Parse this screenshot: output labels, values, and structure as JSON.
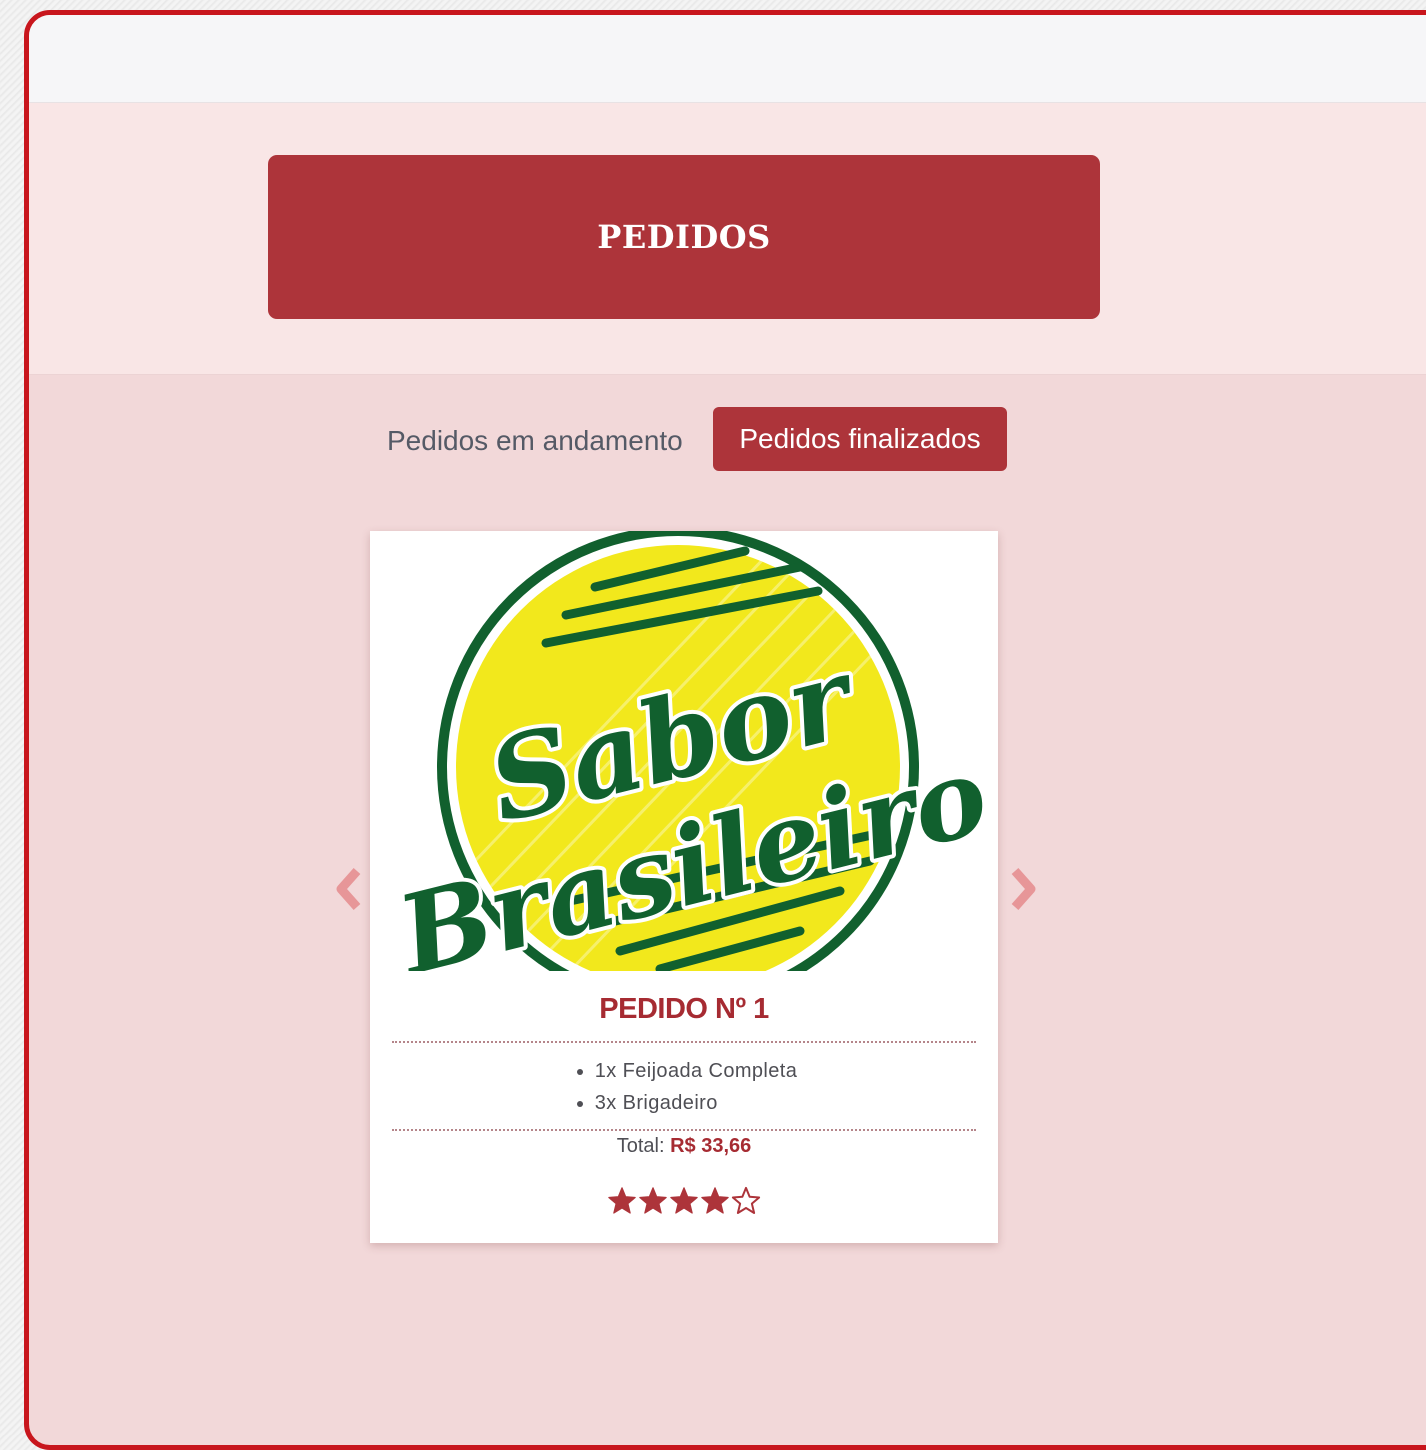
{
  "header": {
    "title": "PEDIDOS"
  },
  "tabs": {
    "in_progress_label": "Pedidos em andamento",
    "finished_label": "Pedidos finalizados",
    "active": "finished"
  },
  "carousel": {
    "prev_icon": "chevron-left-icon",
    "next_icon": "chevron-right-icon"
  },
  "order_card": {
    "logo_text_line1": "Sabor",
    "logo_text_line2": "Brasileiro",
    "title": "PEDIDO Nº 1",
    "items": [
      "1x Feijoada Completa",
      "3x Brigadeiro"
    ],
    "total_label": "Total:",
    "total_value": "R$ 33,66",
    "rating": 4,
    "rating_max": 5
  },
  "colors": {
    "accent": "#ad343a",
    "frame_border": "#c8161d",
    "page_bg": "#f2d8d9",
    "logo_green": "#11602e",
    "logo_yellow": "#f2e81c"
  }
}
